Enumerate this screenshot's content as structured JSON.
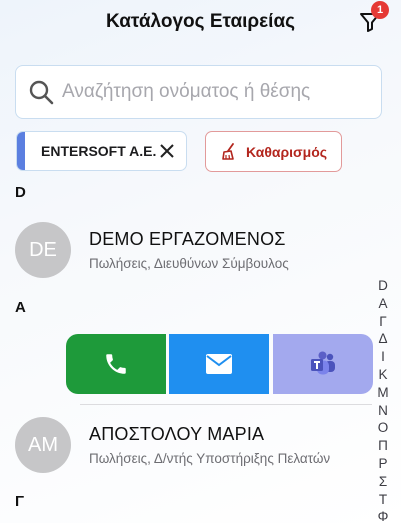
{
  "header": {
    "title": "Κατάλογος Εταιρείας",
    "filter_badge": "1"
  },
  "search": {
    "placeholder": "Αναζήτηση ονόματος ή θέσης",
    "value": ""
  },
  "filter_chip": {
    "label": "ENTERSOFT A.E."
  },
  "clear_button": {
    "label": "Καθαρισμός"
  },
  "sections": [
    {
      "letter": "D",
      "contacts": [
        {
          "initials": "DE",
          "name": "DEMO ΕΡΓΑΖΟΜΕΝΟΣ",
          "role": "Πωλήσεις, Διευθύνων Σύμβουλος"
        }
      ]
    },
    {
      "letter": "Α",
      "contacts": [
        {
          "initials": "AM",
          "name": "ΑΠΟΣΤΟΛΟΥ ΜΑΡΙΑ",
          "role": "Πωλήσεις, Δ/ντής Υποστήριξης Πελατών"
        }
      ]
    },
    {
      "letter": "Γ",
      "contacts": []
    }
  ],
  "swipe_actions": {
    "call_icon": "phone-icon",
    "mail_icon": "mail-icon",
    "teams_icon": "teams-icon",
    "colors": {
      "call": "#1e9a3a",
      "mail": "#1f8ff0",
      "teams": "#a3a9ee"
    }
  },
  "index_letters": [
    "D",
    "Α",
    "Γ",
    "Δ",
    "Ι",
    "Κ",
    "Μ",
    "Ν",
    "Ο",
    "Π",
    "Ρ",
    "Σ",
    "Τ",
    "Φ"
  ],
  "colors": {
    "accent": "#5b7fe0",
    "danger": "#b3261e",
    "badge": "#e53935"
  }
}
